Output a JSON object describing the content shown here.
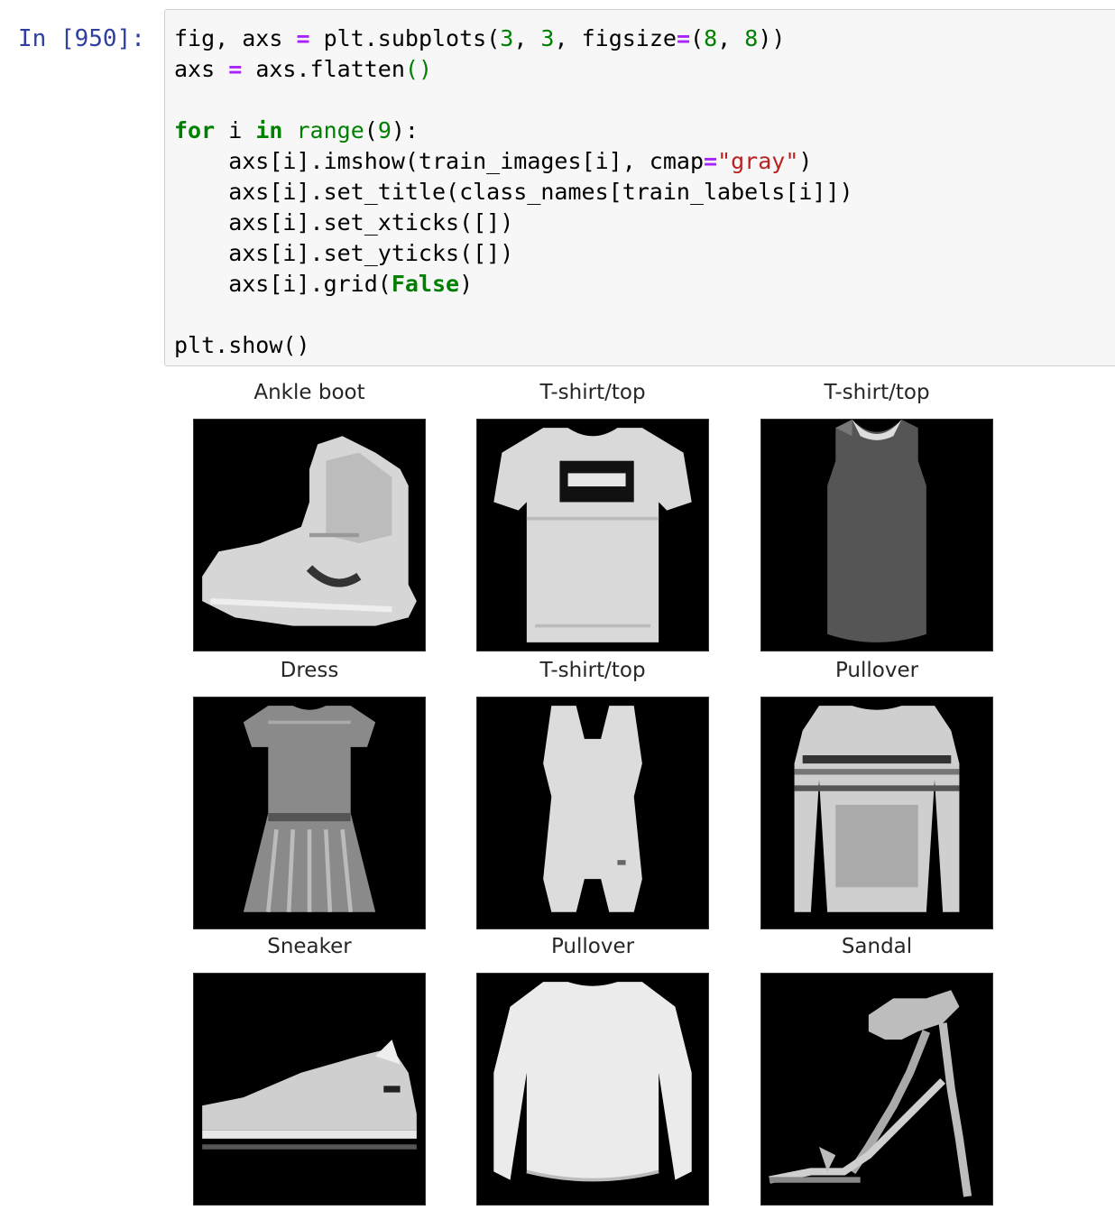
{
  "cell": {
    "prompt": "In [950]:",
    "code_lines": [
      "fig, axs = plt.subplots(3, 3, figsize=(8, 8))",
      "axs = axs.flatten()",
      "",
      "for i in range(9):",
      "    axs[i].imshow(train_images[i], cmap=\"gray\")",
      "    axs[i].set_title(class_names[train_labels[i]])",
      "    axs[i].set_xticks([])",
      "    axs[i].set_yticks([])",
      "    axs[i].grid(False)",
      "",
      "plt.show()"
    ]
  },
  "output": {
    "panels": [
      {
        "title": "Ankle boot",
        "icon": "ankle-boot-image"
      },
      {
        "title": "T-shirt/top",
        "icon": "tshirt-image"
      },
      {
        "title": "T-shirt/top",
        "icon": "tank-top-image"
      },
      {
        "title": "Dress",
        "icon": "dress-image"
      },
      {
        "title": "T-shirt/top",
        "icon": "tank-top-image"
      },
      {
        "title": "Pullover",
        "icon": "pullover-image"
      },
      {
        "title": "Sneaker",
        "icon": "sneaker-image"
      },
      {
        "title": "Pullover",
        "icon": "pullover-image"
      },
      {
        "title": "Sandal",
        "icon": "sandal-image"
      }
    ]
  },
  "colors": {
    "prompt": "#303f9f",
    "keyword": "#008000",
    "operator": "#aa22ff",
    "string": "#ba2121",
    "cell_background": "#f7f7f7"
  }
}
